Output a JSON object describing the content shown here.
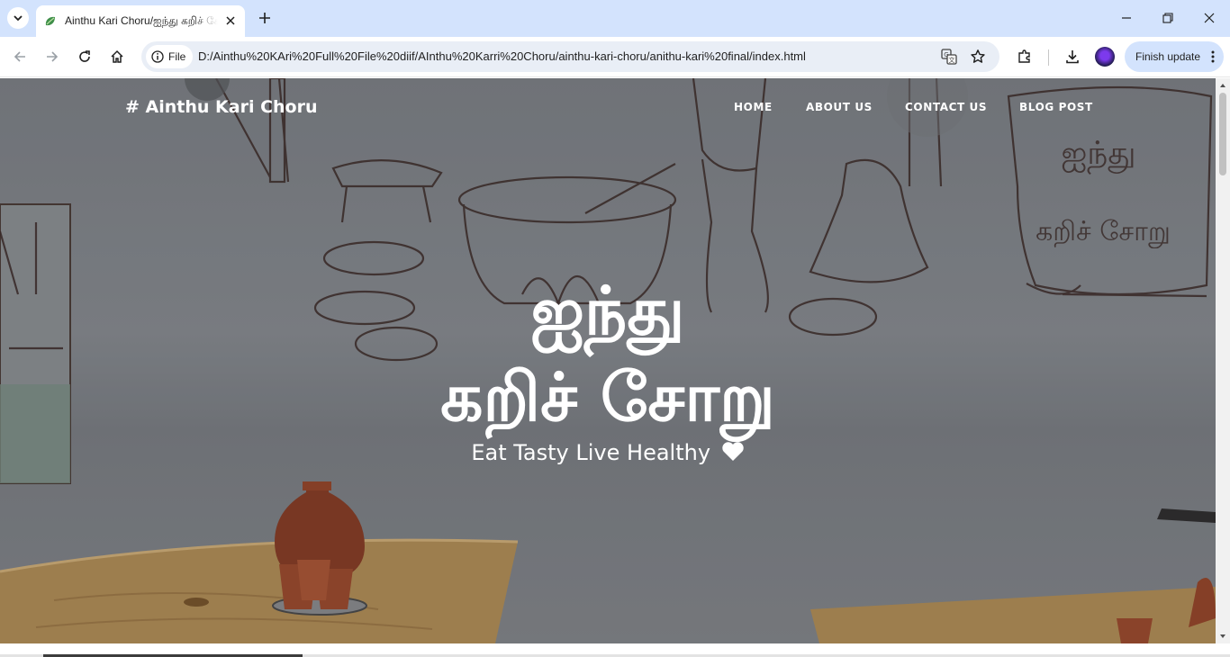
{
  "browser": {
    "tab_title": "Ainthu Kari Choru/ஐந்து கறிச் சோறு",
    "chip_label": "File",
    "url": "D:/Ainthu%20KAri%20Full%20File%20diif/AInthu%20Karri%20Choru/ainthu-kari-choru/anithu-kari%20final/index.html",
    "update_label": "Finish update"
  },
  "site": {
    "brand": "# Ainthu Kari Choru",
    "nav": [
      "HOME",
      "ABOUT US",
      "CONTACT US",
      "BLOG POST"
    ],
    "hero_line1": "ஐந்து",
    "hero_line2": "கறிச் சோறு",
    "tagline": "Eat Tasty Live Healthy"
  },
  "colors": {
    "tabstrip": "#d3e3fd",
    "omnibox": "#e9eef6",
    "hero_text": "#ffffff"
  }
}
